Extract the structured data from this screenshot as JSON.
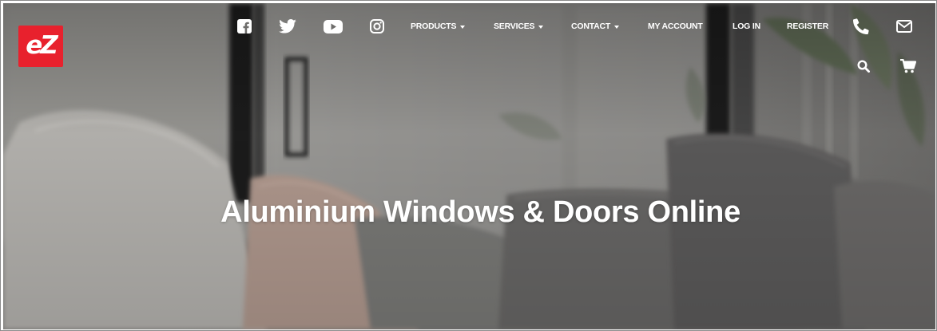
{
  "brand": {
    "logo_text": "eZ",
    "logo_color": "#e8212d"
  },
  "social": [
    {
      "name": "facebook-icon"
    },
    {
      "name": "twitter-icon"
    },
    {
      "name": "youtube-icon"
    },
    {
      "name": "instagram-icon"
    }
  ],
  "nav": {
    "products": "PRODUCTS",
    "services": "SERVICES",
    "contact": "CONTACT",
    "my_account": "MY ACCOUNT",
    "log_in": "LOG IN",
    "register": "REGISTER"
  },
  "utility_icons": [
    "phone-icon",
    "envelope-icon",
    "search-icon",
    "cart-icon"
  ],
  "hero": {
    "title": "Aluminium Windows & Doors Online"
  }
}
